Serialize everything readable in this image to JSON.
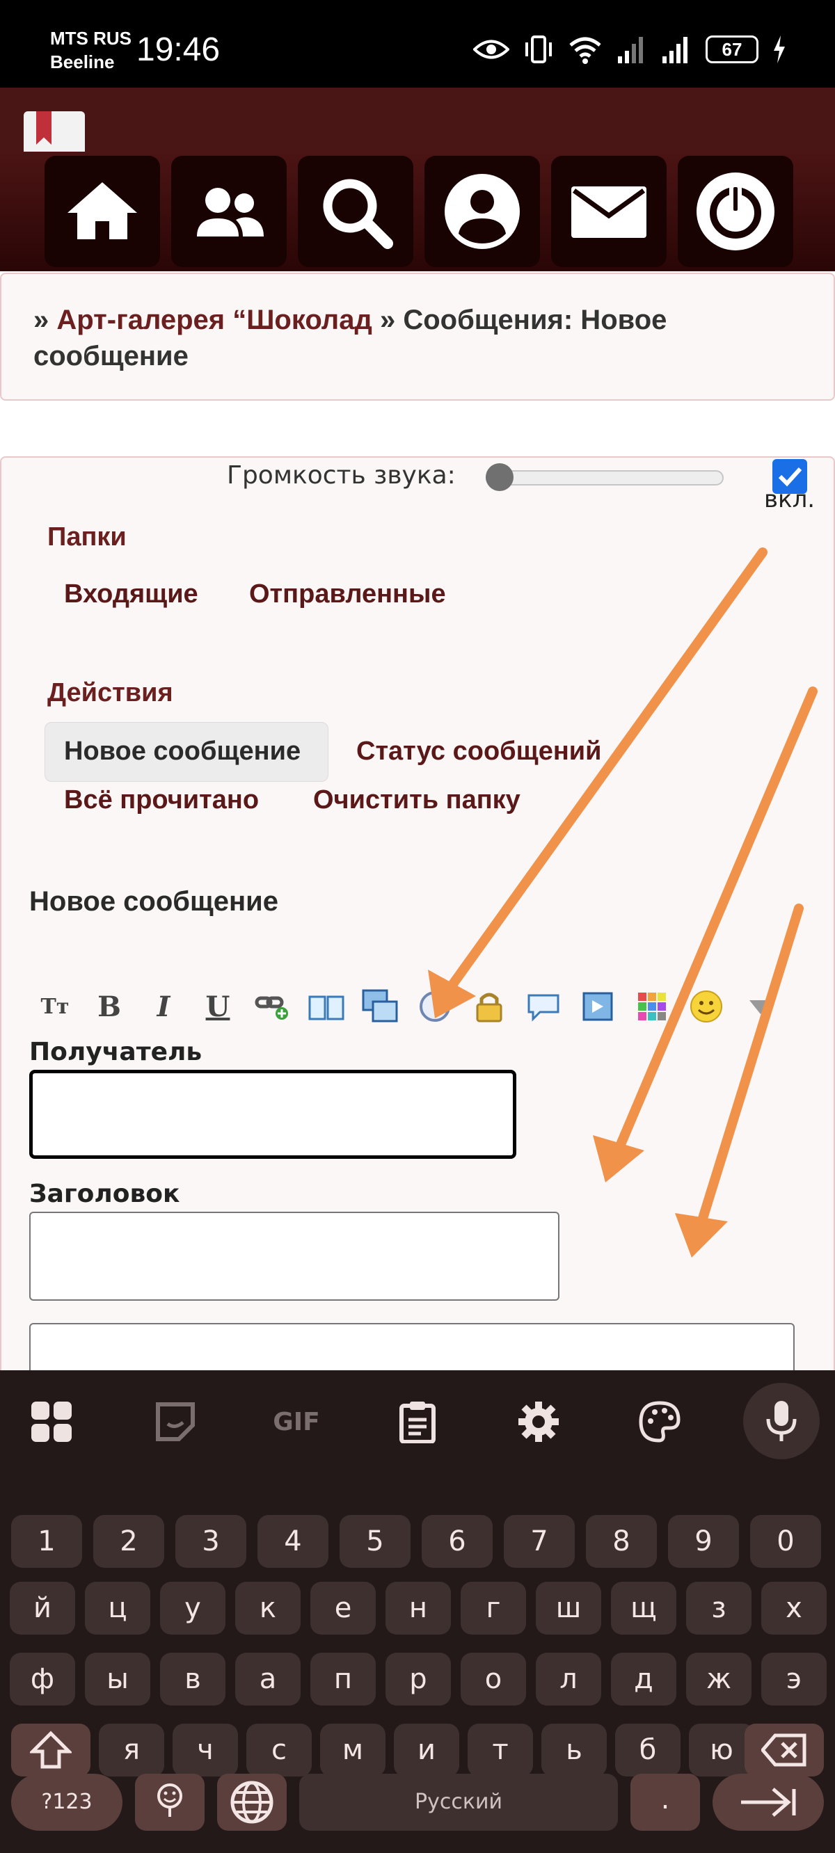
{
  "status_bar": {
    "carrier_line1": "MTS RUS",
    "carrier_line2": "Beeline",
    "time": "19:46",
    "battery": "67"
  },
  "nav": {
    "icons": [
      "home-icon",
      "users-icon",
      "search-icon",
      "profile-icon",
      "mail-icon",
      "power-icon"
    ]
  },
  "breadcrumb": {
    "prefix": "» ",
    "link": "Арт-галерея “Шоколад",
    "separator": " » ",
    "current": "Сообщения: Новое сообщение"
  },
  "volume": {
    "label": "Громкость звука:",
    "level": 0.0,
    "enabled_label": "вкл.",
    "enabled": true
  },
  "folders": {
    "title": "Папки",
    "items": [
      "Входящие",
      "Отправленные"
    ]
  },
  "actions": {
    "title": "Действия",
    "items": [
      "Новое сообщение",
      "Статус сообщений",
      "Всё прочитано",
      "Очистить папку"
    ],
    "active": "Новое сообщение"
  },
  "form": {
    "title": "Новое сообщение",
    "toolbar_icons": [
      "text-size-icon",
      "bold-icon",
      "italic-icon",
      "underline-icon",
      "link-icon",
      "book-icon",
      "images-icon",
      "clock-icon",
      "lock-icon",
      "speech-bubble-icon",
      "media-icon",
      "color-grid-icon",
      "smiley-icon",
      "dropdown-arrow-icon"
    ],
    "toolbar_glyphs": {
      "text_size": "Tт",
      "bold": "B",
      "italic": "I",
      "underline": "U"
    },
    "recipient_label": "Получатель",
    "recipient_value": "",
    "subject_label": "Заголовок",
    "subject_value": "",
    "body_value": ""
  },
  "keyboard": {
    "tools": [
      "apps-icon",
      "sticker-icon",
      "GIF",
      "clipboard-icon",
      "settings-icon",
      "palette-icon",
      "mic-icon"
    ],
    "rows": [
      [
        "1",
        "2",
        "3",
        "4",
        "5",
        "6",
        "7",
        "8",
        "9",
        "0"
      ],
      [
        "й",
        "ц",
        "у",
        "к",
        "е",
        "н",
        "г",
        "ш",
        "щ",
        "з",
        "х"
      ],
      [
        "ф",
        "ы",
        "в",
        "а",
        "п",
        "р",
        "о",
        "л",
        "д",
        "ж",
        "э"
      ],
      [
        "я",
        "ч",
        "с",
        "м",
        "и",
        "т",
        "ь",
        "б",
        "ю"
      ]
    ],
    "symbols_key": "?123",
    "space_label": "Русский",
    "period_key": "."
  },
  "colors": {
    "header": "#4a1515",
    "link": "#6b1f1f",
    "arrow": "#f0924a",
    "keyboard_bg": "#231918",
    "key": "#3d302f"
  }
}
